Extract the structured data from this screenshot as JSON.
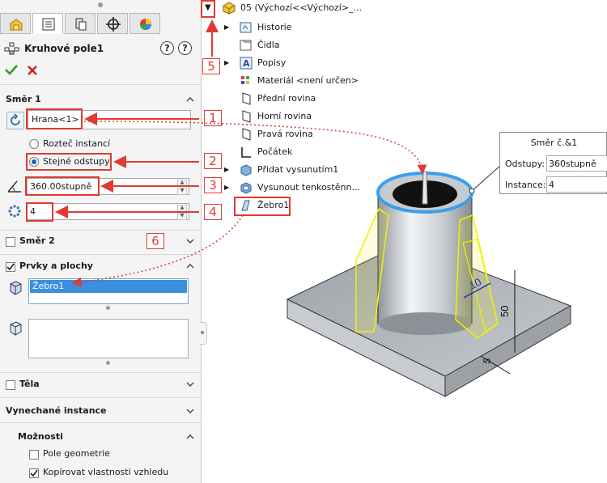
{
  "property_manager": {
    "feature_title": "Kruhové pole1",
    "help_glyph": "?",
    "direction1": {
      "title": "Směr 1",
      "edge_value": "Hrana<1>",
      "option_instance_spacing": "Rozteč instancí",
      "option_equal_spacing": "Stejné odstupy",
      "angle_value": "360.00stupně",
      "instances_value": "4"
    },
    "direction2": {
      "title": "Směr 2"
    },
    "features_and_faces": {
      "title": "Prvky a plochy",
      "selected_feature": "Žebro1"
    },
    "bodies": {
      "title": "Těla"
    },
    "skipped_instances": {
      "title": "Vynechané instance"
    },
    "options": {
      "title": "Možnosti",
      "geometry_pattern": "Pole geometrie",
      "copy_appearance": "Kopírovat vlastnosti vzhledu"
    }
  },
  "tree": {
    "root": "05  (Výchozí<<Výchozí>_...",
    "items": [
      "Historie",
      "Čidla",
      "Popisy",
      "Materiál <není určen>",
      "Přední rovina",
      "Horní rovina",
      "Pravá rovina",
      "Počátek",
      "Přidat vysunutím1",
      "Vysunout tenkostěnn...",
      "Žebro1"
    ]
  },
  "dimension_panel": {
    "title": "Směr č.&1",
    "spacing_label": "Odstupy:",
    "spacing_value": "360stupně",
    "instance_label": "Instance:",
    "instance_value": "4"
  },
  "callouts": [
    "1",
    "2",
    "3",
    "4",
    "5",
    "6"
  ],
  "model_dimensions": {
    "rib_thickness": "10",
    "rib_height": "50",
    "base_dim": "5"
  },
  "colors": {
    "callout_red": "#e03a32",
    "selection_blue": "#3aa0e8",
    "rib_yellow": "#f0f000",
    "ok_green": "#2e9a2e",
    "cancel_red": "#d11b1b"
  },
  "icons": [
    "home-part-icon",
    "property-manager-icon",
    "configuration-icon",
    "target-icon",
    "appearance-icon",
    "circular-pattern-icon",
    "help-icon",
    "ok-icon",
    "cancel-icon"
  ]
}
